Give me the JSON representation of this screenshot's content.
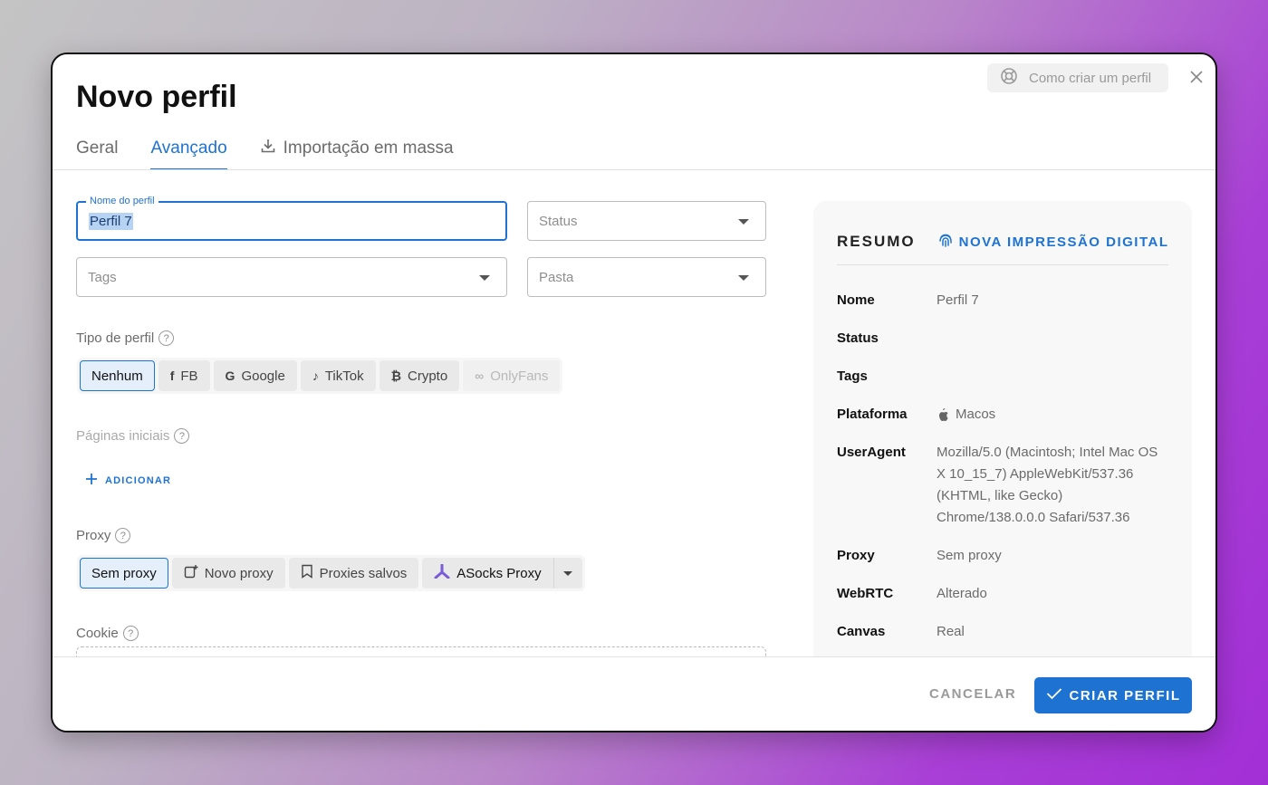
{
  "dialog": {
    "title": "Novo perfil",
    "help_label": "Como criar um perfil"
  },
  "tabs": [
    {
      "label": "Geral",
      "active": false
    },
    {
      "label": "Avançado",
      "active": true
    },
    {
      "label": "Importação em massa",
      "active": false,
      "icon": "download-icon"
    }
  ],
  "form": {
    "name_label": "Nome do perfil",
    "name_value": "Perfil 7",
    "status_placeholder": "Status",
    "tags_placeholder": "Tags",
    "folder_placeholder": "Pasta",
    "profile_type_label": "Tipo de perfil",
    "profile_types": [
      {
        "label": "Nenhum",
        "icon": "",
        "selected": true
      },
      {
        "label": "FB",
        "icon": "f"
      },
      {
        "label": "Google",
        "icon": "G"
      },
      {
        "label": "TikTok",
        "icon": "♪"
      },
      {
        "label": "Crypto",
        "icon": "₿"
      },
      {
        "label": "OnlyFans",
        "icon": "∞",
        "disabled": true
      }
    ],
    "start_pages_label": "Páginas iniciais",
    "add_label": "ADICIONAR",
    "proxy_label": "Proxy",
    "proxy_options": [
      {
        "label": "Sem proxy",
        "selected": true
      },
      {
        "label": "Novo proxy"
      },
      {
        "label": "Proxies salvos"
      },
      {
        "label": "ASocks Proxy"
      }
    ],
    "cookie_label": "Cookie"
  },
  "summary": {
    "title": "RESUMO",
    "fingerprint_label": "NOVA IMPRESSÃO DIGITAL",
    "rows": [
      {
        "key": "Nome",
        "value": "Perfil 7"
      },
      {
        "key": "Status",
        "value": ""
      },
      {
        "key": "Tags",
        "value": ""
      },
      {
        "key": "Plataforma",
        "value": "Macos"
      },
      {
        "key": "UserAgent",
        "value": "Mozilla/5.0 (Macintosh; Intel Mac OS X 10_15_7) AppleWebKit/537.36 (KHTML, like Gecko) Chrome/138.0.0.0 Safari/537.36"
      },
      {
        "key": "Proxy",
        "value": "Sem proxy"
      },
      {
        "key": "WebRTC",
        "value": "Alterado"
      },
      {
        "key": "Canvas",
        "value": "Real"
      }
    ]
  },
  "footer": {
    "cancel_label": "CANCELAR",
    "create_label": "CRIAR PERFIL"
  },
  "colors": {
    "accent": "#1e73d2"
  }
}
